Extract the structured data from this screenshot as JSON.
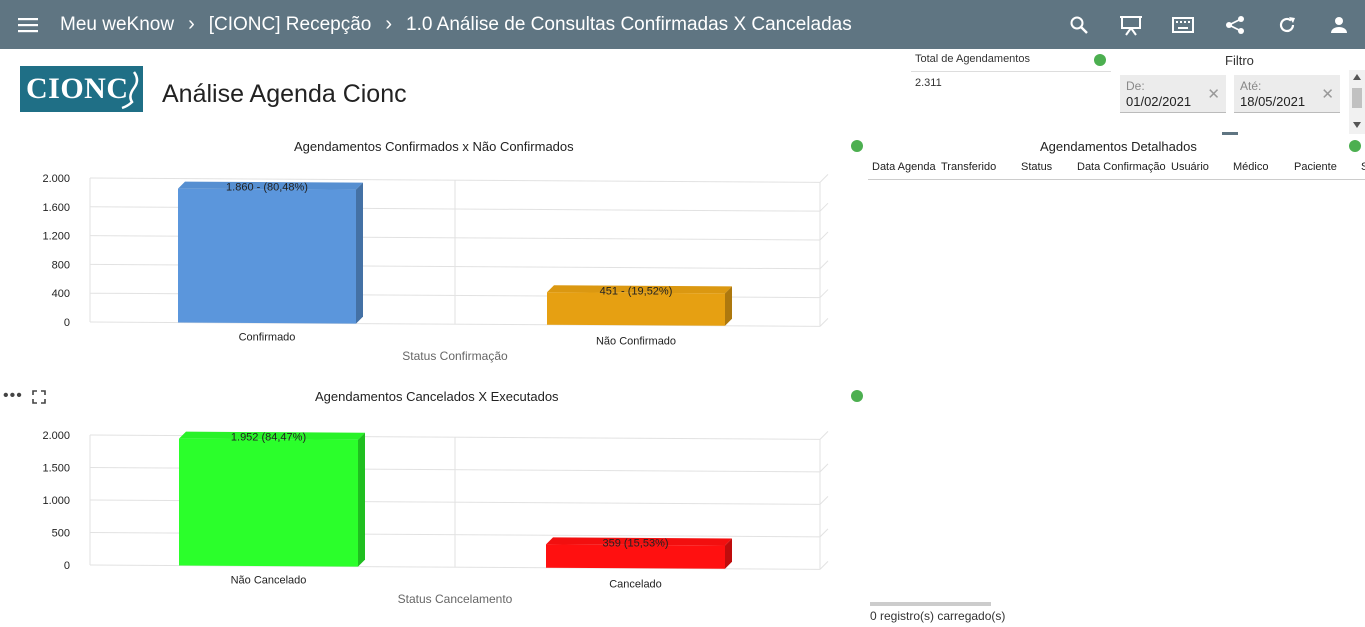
{
  "topbar": {
    "breadcrumbs": [
      "Meu weKnow",
      "[CIONC] Recepção",
      "1.0 Análise de Consultas Confirmadas X Canceladas"
    ],
    "icons": [
      "menu-icon",
      "search-icon",
      "presentation-icon",
      "keyboard-icon",
      "share-icon",
      "refresh-icon",
      "user-icon"
    ]
  },
  "logo_text": "CIONC",
  "page_title": "Análise Agenda Cionc",
  "kpi": {
    "label": "Total de Agendamentos",
    "value": "2.311",
    "status_color": "#4caf50"
  },
  "filter": {
    "title": "Filtro",
    "from": {
      "label": "De:",
      "value": "01/02/2021"
    },
    "to": {
      "label": "Até:",
      "value": "18/05/2021"
    }
  },
  "detail_table": {
    "title": "Agendamentos Detalhados",
    "columns": [
      "Data Agenda",
      "Transferido",
      "Status",
      "Data Confirmação",
      "Usuário",
      "Médico",
      "Paciente",
      "S"
    ],
    "footer": "0 registro(s) carregado(s)"
  },
  "chart_data": [
    {
      "type": "bar",
      "title": "Agendamentos Confirmados x Não Confirmados",
      "xlabel": "Status Confirmação",
      "ylabel": "",
      "categories": [
        "Confirmado",
        "Não Confirmado"
      ],
      "values": [
        1860,
        451
      ],
      "data_labels": [
        "1.860 - (80,48%)",
        "451 - (19,52%)"
      ],
      "colors": [
        "#5b96dc",
        "#e6a012"
      ],
      "ylim": [
        0,
        2000
      ],
      "yticks": [
        0,
        400,
        800,
        1200,
        1600,
        2000
      ],
      "ytick_labels": [
        "0",
        "400",
        "800",
        "1.200",
        "1.600",
        "2.000"
      ],
      "grid": true
    },
    {
      "type": "bar",
      "title": "Agendamentos Cancelados X Executados",
      "xlabel": "Status Cancelamento",
      "ylabel": "",
      "categories": [
        "Não Cancelado",
        "Cancelado"
      ],
      "values": [
        1952,
        359
      ],
      "data_labels": [
        "1.952 (84,47%)",
        "359 (15,53%)"
      ],
      "colors": [
        "#2bff2b",
        "#ff1010"
      ],
      "ylim": [
        0,
        2000
      ],
      "yticks": [
        0,
        500,
        1000,
        1500,
        2000
      ],
      "ytick_labels": [
        "0",
        "500",
        "1.000",
        "1.500",
        "2.000"
      ],
      "grid": true
    }
  ]
}
